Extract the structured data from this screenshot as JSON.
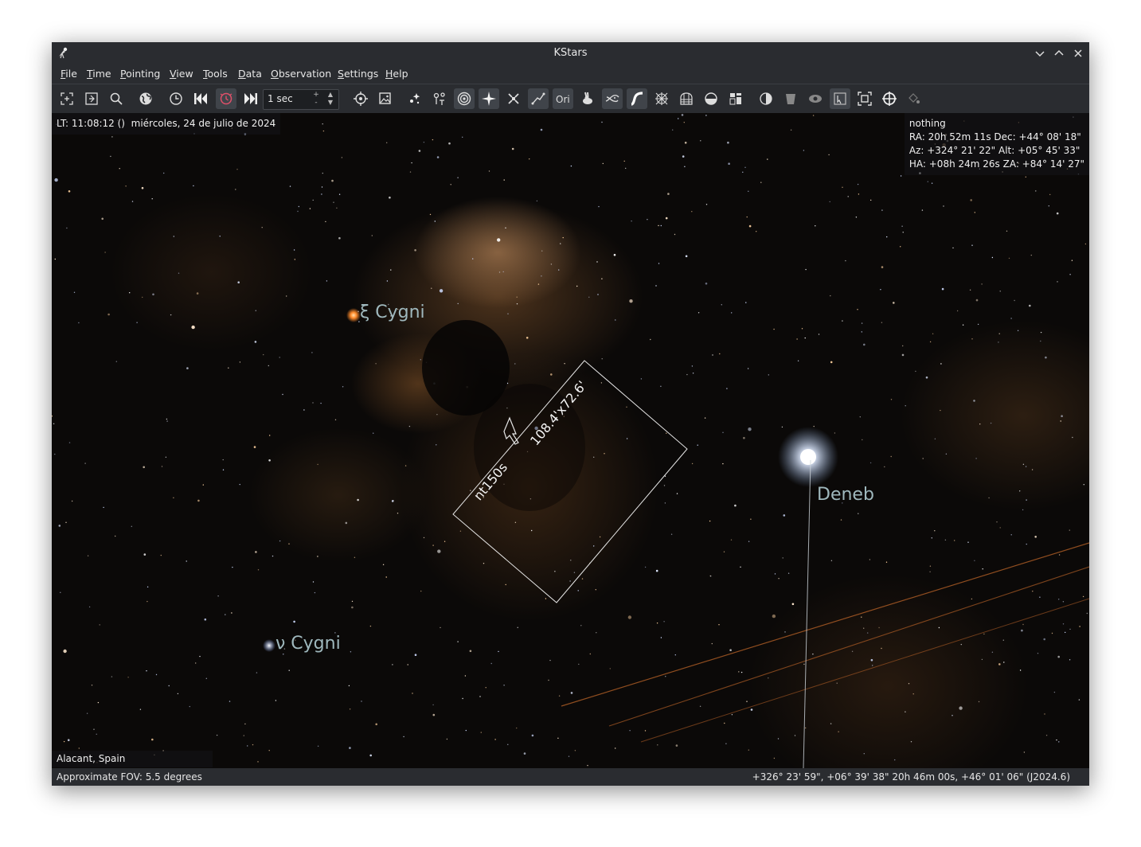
{
  "window": {
    "title": "KStars"
  },
  "menu": [
    "File",
    "Time",
    "Pointing",
    "View",
    "Tools",
    "Data",
    "Observation",
    "Settings",
    "Help"
  ],
  "toolbar": {
    "time_step": "1 sec",
    "spin_plus": "+",
    "spin_minus": "-"
  },
  "sky": {
    "local_time": "LT: 11:08:12 ()",
    "date": "miércoles, 24 de julio de 2024",
    "object": {
      "name": "nothing",
      "ra_dec": "RA: 20h 52m 11s  Dec: +44° 08' 18\"",
      "az_alt": "Az: +324° 21' 22\"  Alt: +05° 45' 33\"",
      "ha_za": "HA: +08h 24m 26s  ZA: +84° 14' 27\""
    },
    "location": "Alacant, Spain",
    "star_labels": {
      "xi_cygni": "ξ Cygni",
      "deneb": "Deneb",
      "nu_cygni": "ν Cygni"
    },
    "fov": {
      "name": "nt150s",
      "size": "108.4'x72.6'"
    }
  },
  "status": {
    "fov": "Approximate FOV: 5.5 degrees",
    "coords": "+326° 23' 59\", +06° 39' 38\"  20h 46m 00s, +46° 01' 06\" (J2024.6)"
  },
  "colors": {
    "window_bg": "#2a2c30",
    "sky_bg": "#0b0908",
    "nebula": "#a0703c",
    "star_label": "#9fb8bd",
    "deneb": "#e8f1ff",
    "xi_cygni": "#ff9a3c"
  }
}
